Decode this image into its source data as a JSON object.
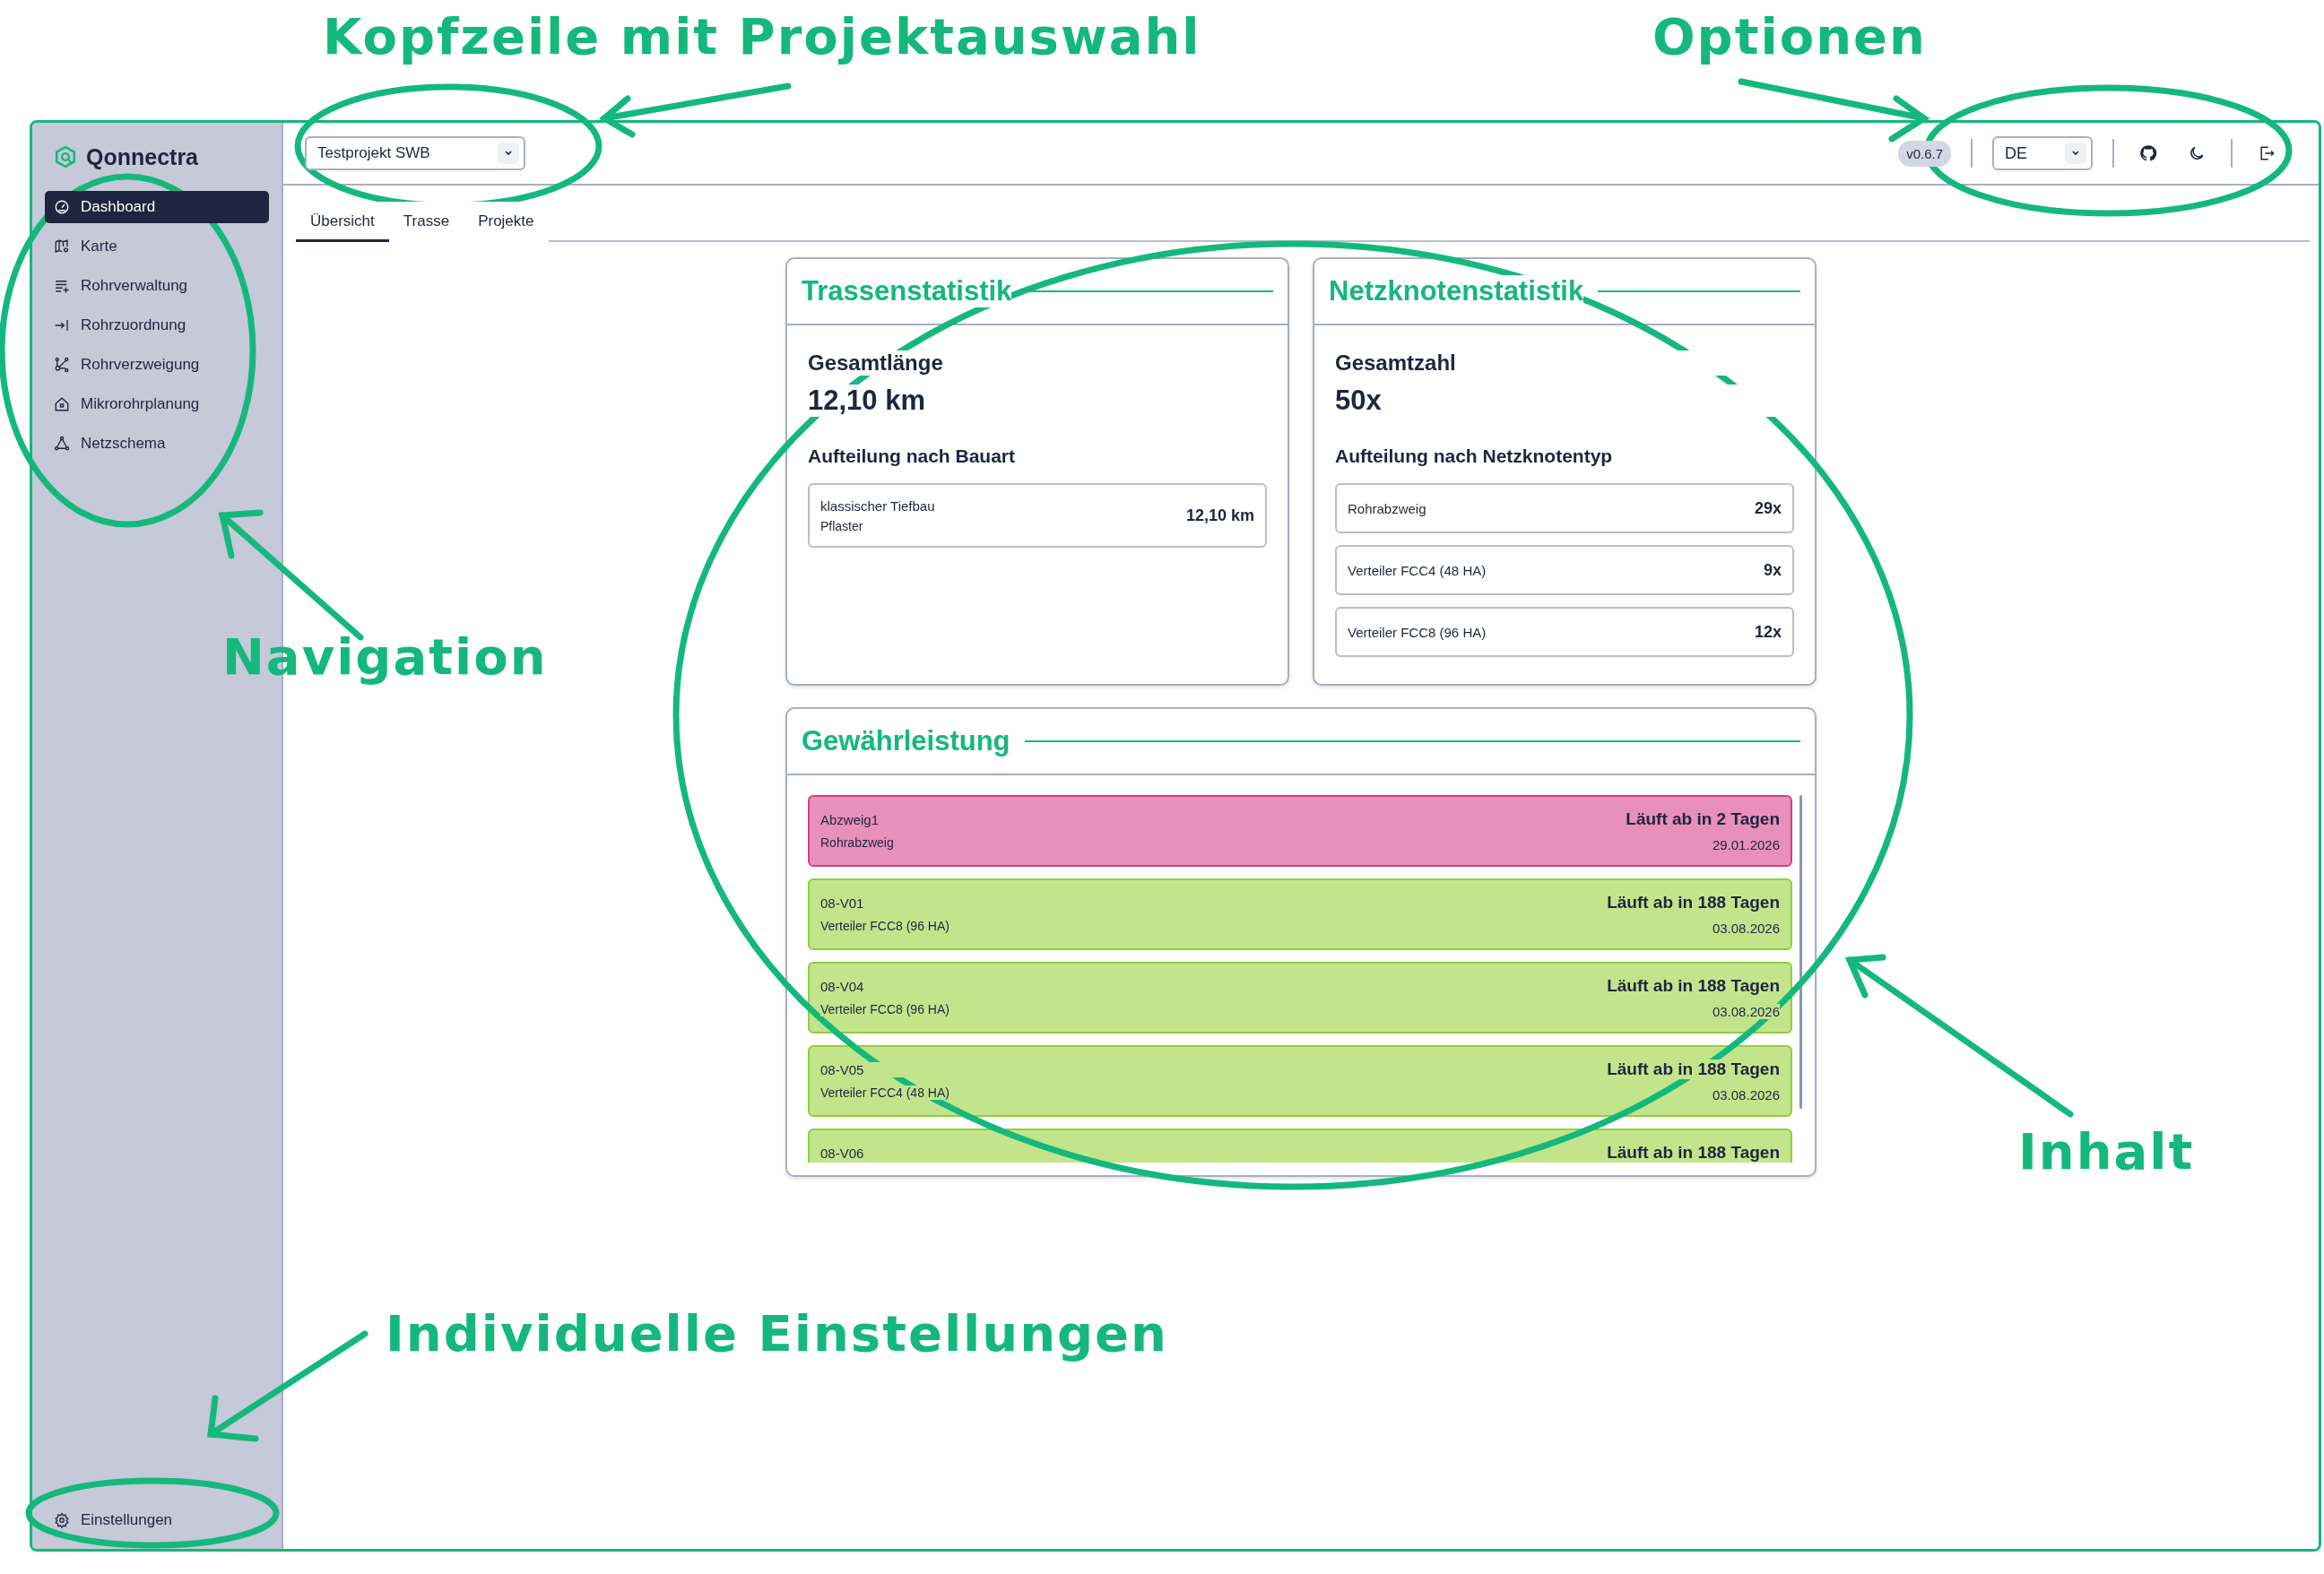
{
  "annotations": [
    {
      "kind": "header",
      "text": "Kopfzeile mit Projektauswahl"
    },
    {
      "kind": "options",
      "text": "Optionen"
    },
    {
      "kind": "navigation",
      "text": "Navigation"
    },
    {
      "kind": "content",
      "text": "Inhalt"
    },
    {
      "kind": "settings",
      "text": "Individuelle Einstellungen"
    }
  ],
  "sidebar": {
    "brand": "Qonnectra",
    "items": [
      {
        "label": "Dashboard",
        "selected": true
      },
      {
        "label": "Karte",
        "selected": false
      },
      {
        "label": "Rohrverwaltung",
        "selected": false
      },
      {
        "label": "Rohrzuordnung",
        "selected": false
      },
      {
        "label": "Rohrverzweigung",
        "selected": false
      },
      {
        "label": "Mikrorohrplanung",
        "selected": false
      },
      {
        "label": "Netzschema",
        "selected": false
      }
    ],
    "footer": {
      "label": "Einstellungen"
    }
  },
  "header": {
    "project_select": {
      "value": "Testprojekt SWB"
    },
    "version": "v0.6.7",
    "language_select": {
      "value": "DE"
    }
  },
  "tabs": [
    {
      "label": "Übersicht",
      "selected": true
    },
    {
      "label": "Trasse",
      "selected": false
    },
    {
      "label": "Projekte",
      "selected": false
    }
  ],
  "route_stats": {
    "title": "Trassenstatistik",
    "total_label": "Gesamtlänge",
    "total_value": "12,10 km",
    "breakdown_title": "Aufteilung nach Bauart",
    "rows": [
      {
        "primary": "klassischer Tiefbau",
        "secondary": "Pflaster",
        "value": "12,10 km"
      }
    ]
  },
  "node_stats": {
    "title": "Netzknotenstatistik",
    "total_label": "Gesamtzahl",
    "total_value": "50x",
    "breakdown_title": "Aufteilung nach Netzknotentyp",
    "rows": [
      {
        "primary": "Rohrabzweig",
        "value": "29x"
      },
      {
        "primary": "Verteiler FCC4 (48 HA)",
        "value": "9x"
      },
      {
        "primary": "Verteiler FCC8 (96 HA)",
        "value": "12x"
      }
    ]
  },
  "warranty": {
    "title": "Gewährleistung",
    "items": [
      {
        "name": "Abzweig1",
        "type": "Rohrabzweig",
        "status": "Läuft ab in 2 Tagen",
        "date": "29.01.2026",
        "color": "#e88fbb"
      },
      {
        "name": "08-V01",
        "type": "Verteiler FCC8 (96 HA)",
        "status": "Läuft ab in 188 Tagen",
        "date": "03.08.2026",
        "color": "#c2e58c"
      },
      {
        "name": "08-V04",
        "type": "Verteiler FCC8 (96 HA)",
        "status": "Läuft ab in 188 Tagen",
        "date": "03.08.2026",
        "color": "#c2e58c"
      },
      {
        "name": "08-V05",
        "type": "Verteiler FCC4 (48 HA)",
        "status": "Läuft ab in 188 Tagen",
        "date": "03.08.2026",
        "color": "#c2e58c"
      },
      {
        "name": "08-V06",
        "status": "Läuft ab in 188 Tagen",
        "color": "#c2e58c"
      }
    ]
  }
}
